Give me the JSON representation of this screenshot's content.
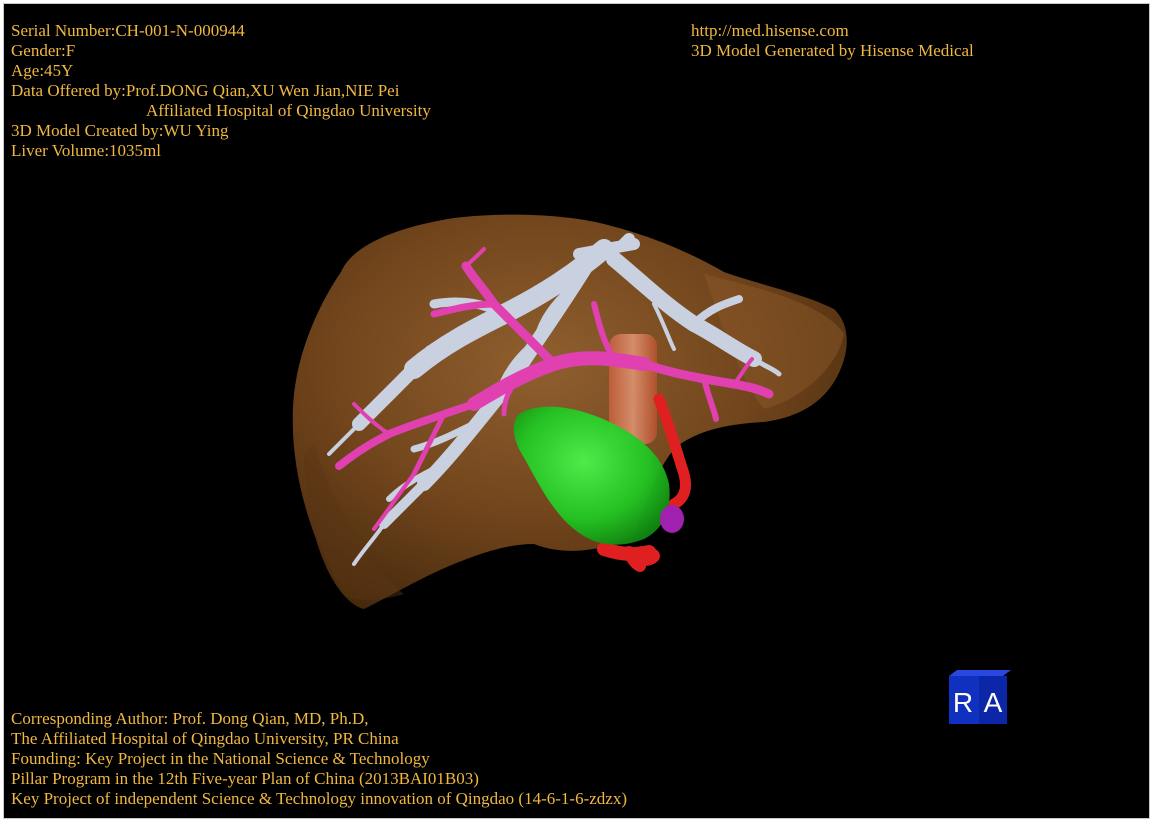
{
  "patient_info": {
    "serial_number": "Serial Number:CH-001-N-000944",
    "gender": "Gender:F",
    "age": "Age:45Y",
    "data_offered_by": "Data Offered by:Prof.DONG Qian,XU Wen Jian,NIE Pei",
    "data_offered_affiliation": "Affiliated Hospital of Qingdao University",
    "model_created_by": "3D Model Created by:WU Ying",
    "liver_volume": "Liver Volume:1035ml"
  },
  "site_info": {
    "url": "http://med.hisense.com",
    "generator": "3D Model Generated by Hisense Medical"
  },
  "credits": {
    "corresponding_author": "Corresponding Author: Prof. Dong Qian, MD, Ph.D,",
    "affiliation": "The Affiliated Hospital of Qingdao University, PR China",
    "founding": "Founding: Key Project in the National Science & Technology",
    "program": "Pillar Program in the 12th Five-year Plan of China (2013BAI01B03)",
    "key_project": "Key Project of independent Science & Technology innovation of Qingdao (14-6-1-6-zdzx)"
  },
  "orientation_cube": {
    "left_label": "R",
    "right_label": "A"
  },
  "colors": {
    "background": "#000000",
    "overlay_text": "#f0b840",
    "liver_parenchyma": "#7a4a1e",
    "hepatic_veins": "#c9d0e0",
    "portal_vein": "#e040b0",
    "gallbladder": "#22c322",
    "arteries": "#e02020",
    "cube_face": "#1030c0"
  }
}
